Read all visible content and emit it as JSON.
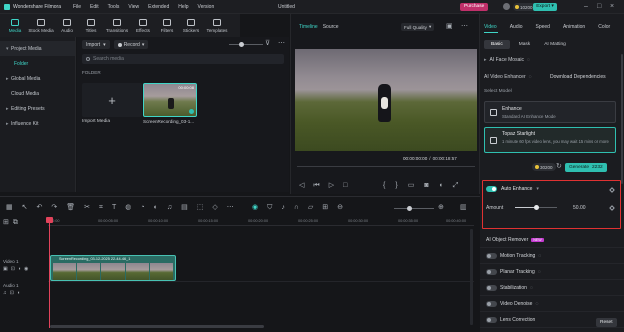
{
  "titlebar": {
    "app_name": "Wondershare Filmora",
    "menus": [
      "File",
      "Edit",
      "Tools",
      "View",
      "Extended",
      "Help",
      "Version"
    ],
    "doc_title": "Untitled",
    "credits": "10200",
    "purchase": "Purchase",
    "export": "Export"
  },
  "topnav": {
    "items": [
      "Media",
      "Stock Media",
      "Audio",
      "Titles",
      "Transitions",
      "Effects",
      "Filters",
      "Stickers",
      "Templates"
    ],
    "active": "Media"
  },
  "sidebar": {
    "items": [
      "Project Media",
      "Folder",
      "Global Media",
      "Cloud Media",
      "Editing Presets",
      "Influence Kit"
    ]
  },
  "media": {
    "import_label": "Import",
    "record_label": "Record",
    "search_placeholder": "Search media",
    "folder_heading": "FOLDER",
    "import_tile_label": "Import Media",
    "clip_label": "ScreenRecording_03-1...",
    "clip_duration": "00:00:08"
  },
  "preview": {
    "tabs": [
      "Timeline",
      "Source"
    ],
    "quality": "Full Quality",
    "current_time": "00:00:00:00",
    "separator": "/",
    "total_time": "00:00:18:57"
  },
  "props": {
    "tabs": [
      "Video",
      "Audio",
      "Speed",
      "Animation",
      "Color"
    ],
    "subtabs": [
      "Basic",
      "Mask",
      "AI Matting"
    ],
    "ai_face_mosaic": "AI Face Mosaic",
    "ai_video_enhancer": "AI Video Enhancer",
    "download_dependencies": "Download Dependencies",
    "select_model": "Select Model",
    "enhance_title": "Enhance",
    "enhance_sub": "Standard AI Enhance Mode",
    "topaz_title": "Topaz Starlight",
    "topaz_sub": "1 minute 60 fps video lens, you may wait 15 mins or more",
    "cost": "30200",
    "generate_label": "Generate",
    "generate_cost": "2232",
    "auto_enhance": "Auto Enhance",
    "amount_label": "Amount",
    "amount_value": "50.00",
    "amount_fraction": 0.5,
    "sections": [
      "AI Object Remover",
      "Motion Tracking",
      "Planar Tracking",
      "Stabilization",
      "Video Denoise",
      "Lens Correction"
    ],
    "ai_object_remover_badge": "NEW",
    "reset_label": "Reset"
  },
  "timeline": {
    "ruler_labels": [
      "00:00",
      "00:00:05:00",
      "00:00:10:00",
      "00:00:15:00",
      "00:00:20:00",
      "00:00:25:00",
      "00:00:30:00",
      "00:00:35:00",
      "00:00:40:00"
    ],
    "video_track": "Video 1",
    "audio_track": "Audio 1",
    "clip_name": "ScreenRecording_03-12-2025 22-44-46_1"
  },
  "colors": {
    "accent": "#2fbfb0",
    "purchase": "#c0306a",
    "export": "#2fbfb0",
    "highlight_box": "#e03232",
    "playhead": "#e2435b"
  }
}
